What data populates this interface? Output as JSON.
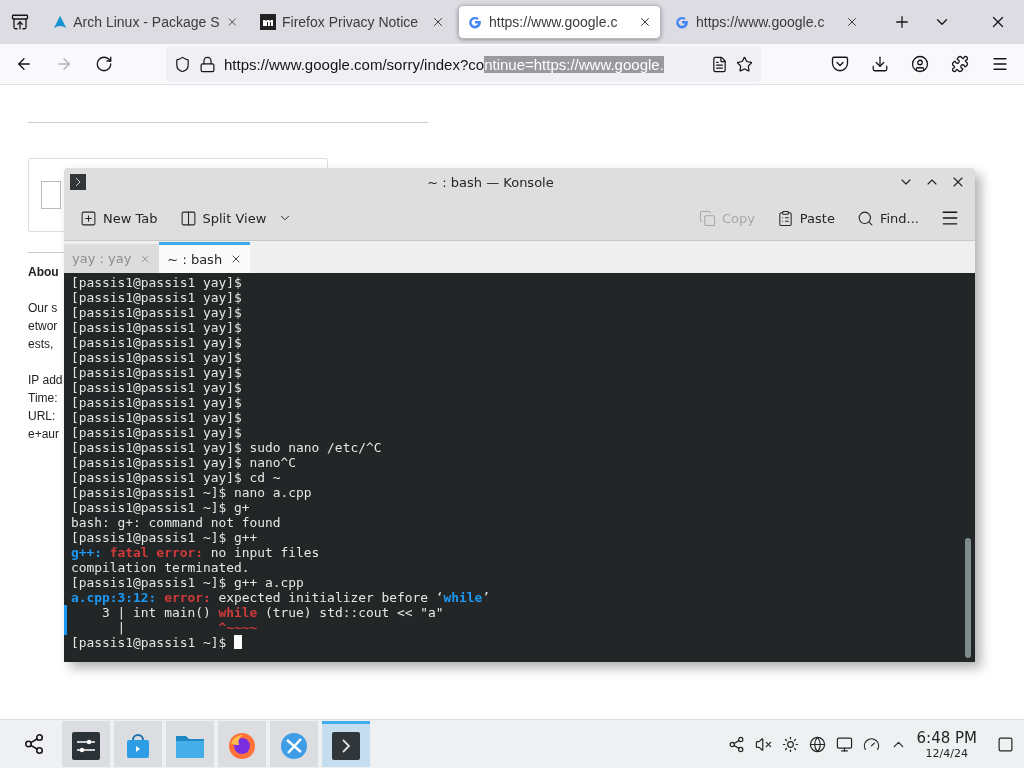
{
  "browser": {
    "tabs": [
      {
        "title": "Arch Linux - Package S",
        "kind": "arch",
        "selected": false
      },
      {
        "title": "Firefox Privacy Notice",
        "kind": "mozilla",
        "selected": false
      },
      {
        "title": "https://www.google.c",
        "kind": "google",
        "selected": true
      },
      {
        "title": "https://www.google.c",
        "kind": "google",
        "selected": false
      }
    ],
    "url": "https://www.google.com/sorry/index?co",
    "url_selected": "ntinue=https://www.google."
  },
  "page": {
    "texts": [
      {
        "text": "Abou",
        "kind": "heading"
      },
      {
        "text": "Our s",
        "kind": "body"
      },
      {
        "text": "etwor",
        "kind": "body"
      },
      {
        "text": "ests,",
        "kind": "body"
      },
      {
        "kind": "gap"
      },
      {
        "text": "IP add",
        "kind": "body"
      },
      {
        "text": "Time:",
        "kind": "body"
      },
      {
        "text": "URL:",
        "kind": "body"
      },
      {
        "text": "e+aur",
        "kind": "body"
      }
    ]
  },
  "konsole": {
    "title": "~ : bash — Konsole",
    "toolbar": [
      {
        "label": "New Tab",
        "kind": "newtab",
        "disabled": false
      },
      {
        "label": "Split View",
        "kind": "split",
        "disabled": false
      },
      {
        "label": "Copy",
        "kind": "copy",
        "disabled": true
      },
      {
        "label": "Paste",
        "kind": "paste",
        "disabled": false
      },
      {
        "label": "Find...",
        "kind": "find",
        "disabled": false
      }
    ],
    "tabs": [
      {
        "label": "yay : yay",
        "selected": false
      },
      {
        "label": "~ : bash",
        "selected": true
      }
    ],
    "lines": [
      {
        "kind": "plain",
        "segments": [
          {
            "text": "[passis1@passis1 yay]$",
            "kind": "plain"
          }
        ]
      },
      {
        "kind": "plain",
        "segments": [
          {
            "text": "[passis1@passis1 yay]$",
            "kind": "plain"
          }
        ]
      },
      {
        "kind": "plain",
        "segments": [
          {
            "text": "[passis1@passis1 yay]$",
            "kind": "plain"
          }
        ]
      },
      {
        "kind": "plain",
        "segments": [
          {
            "text": "[passis1@passis1 yay]$",
            "kind": "plain"
          }
        ]
      },
      {
        "kind": "plain",
        "segments": [
          {
            "text": "[passis1@passis1 yay]$",
            "kind": "plain"
          }
        ]
      },
      {
        "kind": "plain",
        "segments": [
          {
            "text": "[passis1@passis1 yay]$",
            "kind": "plain"
          }
        ]
      },
      {
        "kind": "plain",
        "segments": [
          {
            "text": "[passis1@passis1 yay]$",
            "kind": "plain"
          }
        ]
      },
      {
        "kind": "plain",
        "segments": [
          {
            "text": "[passis1@passis1 yay]$",
            "kind": "plain"
          }
        ]
      },
      {
        "kind": "plain",
        "segments": [
          {
            "text": "[passis1@passis1 yay]$",
            "kind": "plain"
          }
        ]
      },
      {
        "kind": "plain",
        "segments": [
          {
            "text": "[passis1@passis1 yay]$",
            "kind": "plain"
          }
        ]
      },
      {
        "kind": "plain",
        "segments": [
          {
            "text": "[passis1@passis1 yay]$",
            "kind": "plain"
          }
        ]
      },
      {
        "kind": "plain",
        "segments": [
          {
            "text": "[passis1@passis1 yay]$ sudo nano /etc/^C",
            "kind": "plain"
          }
        ]
      },
      {
        "kind": "plain",
        "segments": [
          {
            "text": "[passis1@passis1 yay]$ nano^C",
            "kind": "plain"
          }
        ]
      },
      {
        "kind": "plain",
        "segments": [
          {
            "text": "[passis1@passis1 yay]$ cd ~",
            "kind": "plain"
          }
        ]
      },
      {
        "kind": "plain",
        "segments": [
          {
            "text": "[passis1@passis1 ~]$ nano a.cpp",
            "kind": "plain"
          }
        ]
      },
      {
        "kind": "plain",
        "segments": [
          {
            "text": "[passis1@passis1 ~]$ g+",
            "kind": "plain"
          }
        ]
      },
      {
        "kind": "plain",
        "segments": [
          {
            "text": "bash: g+: command not found",
            "kind": "plain"
          }
        ]
      },
      {
        "kind": "plain",
        "segments": [
          {
            "text": "[passis1@passis1 ~]$ g++",
            "kind": "plain"
          }
        ]
      },
      {
        "kind": "plain",
        "segments": [
          {
            "text": "g++:",
            "kind": "locus"
          },
          {
            "text": " fatal error:",
            "kind": "error"
          },
          {
            "text": " no input files",
            "kind": "plain"
          }
        ]
      },
      {
        "kind": "plain",
        "segments": [
          {
            "text": "compilation terminated.",
            "kind": "plain"
          }
        ]
      },
      {
        "kind": "plain",
        "segments": [
          {
            "text": "[passis1@passis1 ~]$ g++ a.cpp",
            "kind": "plain"
          }
        ]
      },
      {
        "kind": "plain",
        "segments": [
          {
            "text": "a.cpp:3:12:",
            "kind": "locus"
          },
          {
            "text": " error:",
            "kind": "error"
          },
          {
            "text": " expected initializer before ‘",
            "kind": "plain"
          },
          {
            "text": "while",
            "kind": "locus"
          },
          {
            "text": "’",
            "kind": "plain"
          }
        ]
      },
      {
        "kind": "source",
        "segments": [
          {
            "text": "    3 | int main() ",
            "kind": "plain"
          },
          {
            "text": "while",
            "kind": "error"
          },
          {
            "text": " (true) std::cout << \"a\"",
            "kind": "plain"
          }
        ]
      },
      {
        "kind": "source",
        "segments": [
          {
            "text": "      |            ",
            "kind": "plain"
          },
          {
            "text": "^~~~~",
            "kind": "error"
          }
        ]
      },
      {
        "kind": "prompt",
        "segments": [
          {
            "text": "[passis1@passis1 ~]$ ",
            "kind": "plain"
          }
        ]
      }
    ]
  },
  "taskbar": {
    "apps": [
      {
        "kind": "settings",
        "active": false
      },
      {
        "kind": "store",
        "active": false
      },
      {
        "kind": "files",
        "active": false
      },
      {
        "kind": "firefox",
        "active": false
      },
      {
        "kind": "globe",
        "active": false
      },
      {
        "kind": "konsole",
        "active": true
      }
    ],
    "time": "6:48 PM",
    "date": "12/4/24"
  }
}
